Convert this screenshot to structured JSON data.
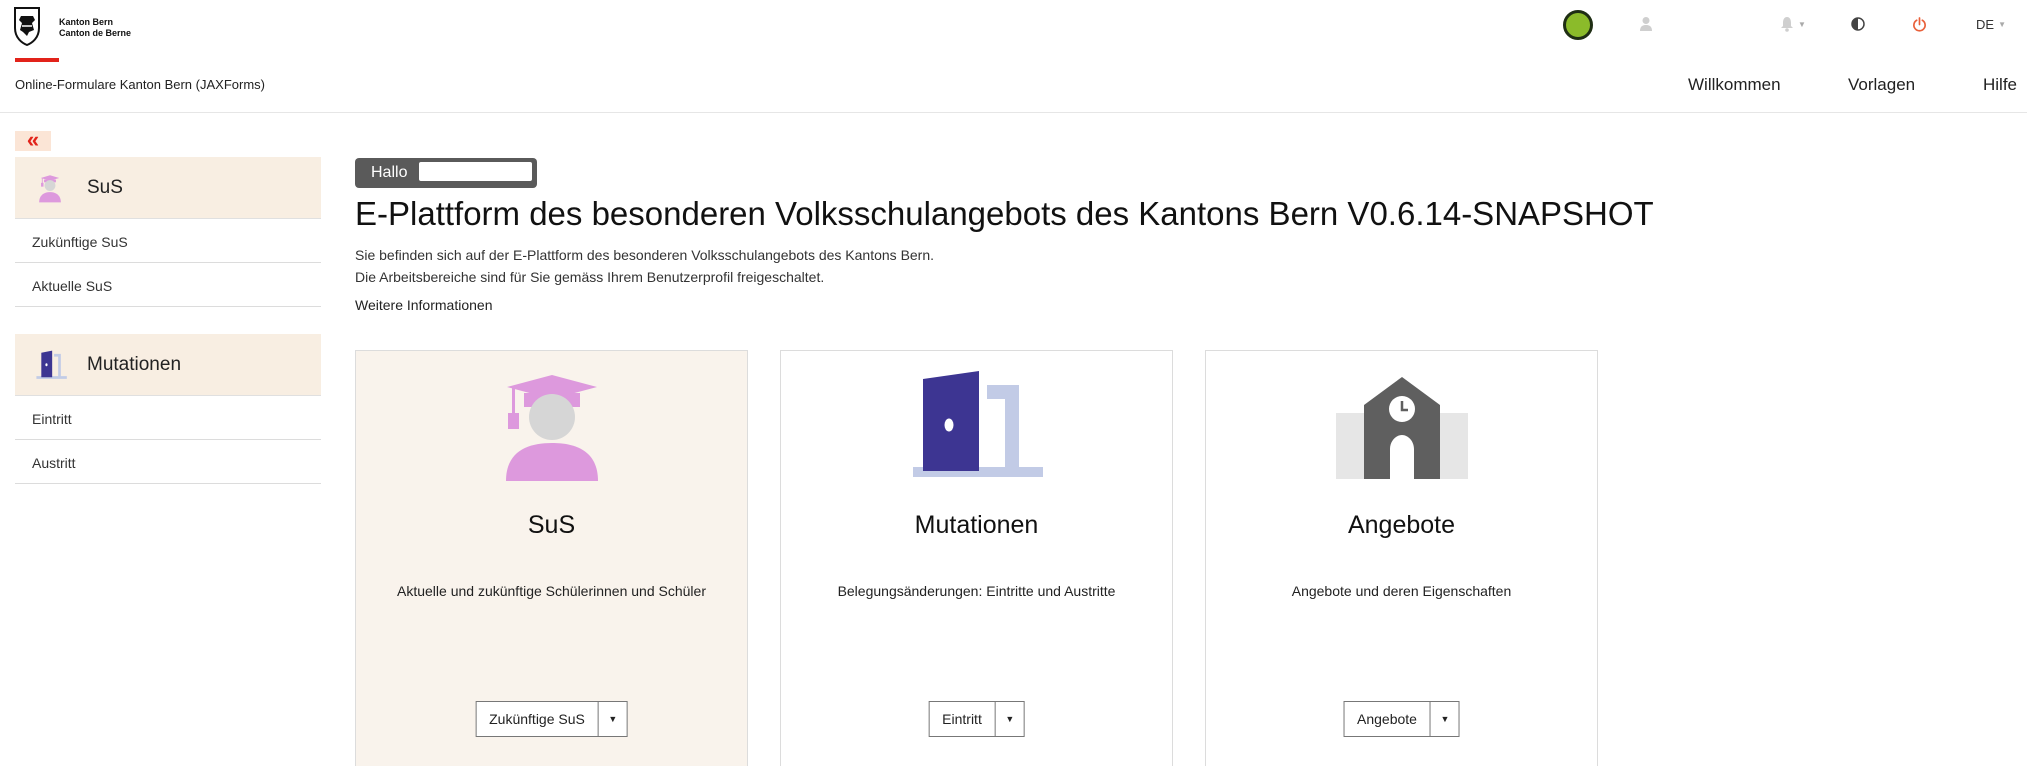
{
  "header": {
    "logo_line1": "Kanton Bern",
    "logo_line2": "Canton de Berne",
    "app_title": "Online-Formulare Kanton Bern (JAXForms)",
    "language": "DE",
    "status_color": "#8bbb2a",
    "icons": [
      "user-icon",
      "bell-icon",
      "contrast-icon",
      "power-icon"
    ],
    "nav": {
      "willkommen": "Willkommen",
      "vorlagen": "Vorlagen",
      "hilfe": "Hilfe"
    }
  },
  "sidebar": {
    "collapse_glyph": "«",
    "sections": [
      {
        "label": "SuS",
        "icon": "student-icon",
        "items": [
          "Zukünftige SuS",
          "Aktuelle SuS"
        ]
      },
      {
        "label": "Mutationen",
        "icon": "door-icon",
        "items": [
          "Eintritt",
          "Austritt"
        ]
      }
    ]
  },
  "main": {
    "greeting": "Hallo",
    "title": "E-Plattform des besonderen Volksschulangebots des Kantons Bern V0.6.14-SNAPSHOT",
    "intro_line1": "Sie befinden sich auf der E-Plattform des besonderen Volksschulangebots des Kantons Bern.",
    "intro_line2": "Die Arbeitsbereiche sind für Sie gemäss Ihrem Benutzerprofil freigeschaltet.",
    "more_info": "Weitere Informationen",
    "cards": [
      {
        "title": "SuS",
        "description": "Aktuelle und zukünftige Schülerinnen und Schüler",
        "button": "Zukünftige SuS",
        "icon": "student-icon"
      },
      {
        "title": "Mutationen",
        "description": "Belegungsänderungen: Eintritte und Austritte",
        "button": "Eintritt",
        "icon": "door-icon"
      },
      {
        "title": "Angebote",
        "description": "Angebote und deren Eigenschaften",
        "button": "Angebote",
        "icon": "school-icon"
      }
    ]
  },
  "colors": {
    "accent_red": "#e2231a",
    "sidebar_bg": "#f8eee2",
    "student_pink": "#dd99dd",
    "door_purple": "#3d3592",
    "frame_blue": "#c2cbe6",
    "school_gray": "#5f5f5f"
  }
}
